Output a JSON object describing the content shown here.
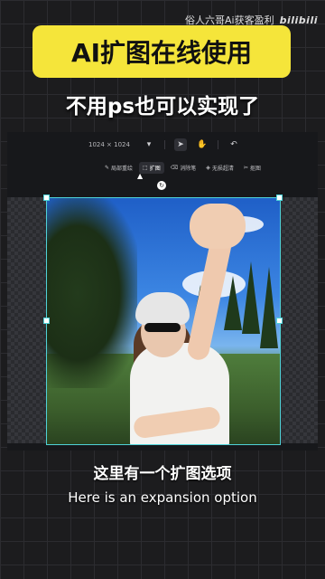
{
  "watermark": {
    "author": "俗人六哥Ai获客盈利",
    "platform": "bilibili"
  },
  "banner": {
    "title": "AI扩图在线使用",
    "subtitle": "不用ps也可以实现了"
  },
  "editor": {
    "canvas_size": "1024 × 1024",
    "topbar_icons": [
      "pointer-icon",
      "hand-icon",
      "undo-icon"
    ],
    "tools": [
      {
        "label": "局部重绘",
        "icon": "brush-icon",
        "active": false
      },
      {
        "label": "扩图",
        "icon": "expand-icon",
        "active": true
      },
      {
        "label": "消除笔",
        "icon": "eraser-icon",
        "active": false
      },
      {
        "label": "无损超清",
        "icon": "hd-icon",
        "active": false
      },
      {
        "label": "抠图",
        "icon": "cutout-icon",
        "active": false
      }
    ]
  },
  "captions": {
    "chinese": "这里有一个扩图选项",
    "english": "Here is an expansion option"
  },
  "colors": {
    "banner_bg": "#f5e53a",
    "selection_border": "#4fd2d8",
    "background": "#1c1c1e"
  }
}
